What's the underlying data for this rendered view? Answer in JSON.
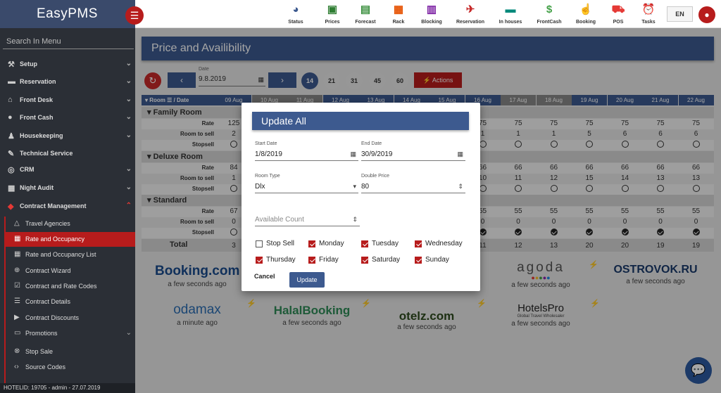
{
  "app": {
    "name": "EasyPMS",
    "menu_icon": "hamburger-icon"
  },
  "sidebar": {
    "search": "Search In Menu",
    "items": [
      {
        "label": "Setup",
        "icon": "gavel-icon"
      },
      {
        "label": "Reservation",
        "icon": "bed-icon"
      },
      {
        "label": "Front Desk",
        "icon": "home-icon"
      },
      {
        "label": "Front Cash",
        "icon": "coins-icon"
      },
      {
        "label": "Housekeeping",
        "icon": "person-icon"
      },
      {
        "label": "Technical Service",
        "icon": "wrench-icon"
      },
      {
        "label": "CRM",
        "icon": "globe-icon"
      },
      {
        "label": "Night Audit",
        "icon": "calendar-icon"
      },
      {
        "label": "Contract Management",
        "icon": "tag-icon"
      }
    ],
    "subitems": [
      {
        "label": "Travel Agencies"
      },
      {
        "label": "Rate and Occupancy"
      },
      {
        "label": "Rate and Occupancy List"
      },
      {
        "label": "Contract Wizard"
      },
      {
        "label": "Contract and Rate Codes"
      },
      {
        "label": "Contract Details"
      },
      {
        "label": "Contract Discounts"
      },
      {
        "label": "Promotions"
      },
      {
        "label": "Stop Sale"
      },
      {
        "label": "Source Codes"
      }
    ],
    "footer": "HOTELID: 19705 - admin - 27.07.2019"
  },
  "toolbar": [
    {
      "label": "Status",
      "icon": "pie-icon",
      "color": "#3d5a8f"
    },
    {
      "label": "Prices",
      "icon": "price-icon",
      "color": "#2e7d32"
    },
    {
      "label": "Forecast",
      "icon": "chart-icon",
      "color": "#388e3c"
    },
    {
      "label": "Rack",
      "icon": "grid-icon",
      "color": "#e65100"
    },
    {
      "label": "Blocking",
      "icon": "calendar-icon",
      "color": "#7b1fa2"
    },
    {
      "label": "Reservation",
      "icon": "plane-icon",
      "color": "#c62828"
    },
    {
      "label": "In houses",
      "icon": "bed-icon",
      "color": "#00897b"
    },
    {
      "label": "FrontCash",
      "icon": "dollar-icon",
      "color": "#43a047"
    },
    {
      "label": "Booking",
      "icon": "hand-icon",
      "color": "#e64a19"
    },
    {
      "label": "POS",
      "icon": "cart-icon",
      "color": "#e53935"
    },
    {
      "label": "Tasks",
      "icon": "alarm-icon",
      "color": "#e53935"
    }
  ],
  "lang": "EN",
  "page": {
    "title": "Price and Availibility"
  },
  "controls": {
    "date_label": "Date",
    "date_value": "9.8.2019",
    "days": [
      "14",
      "21",
      "31",
      "45",
      "60"
    ],
    "actions": "Actions"
  },
  "grid": {
    "header": "Room",
    "header_suffix": "/ Date",
    "dates": [
      "09 Aug",
      "10 Aug",
      "11 Aug",
      "12 Aug",
      "13 Aug",
      "14 Aug",
      "15 Aug",
      "16 Aug",
      "17 Aug",
      "18 Aug",
      "19 Aug",
      "20 Aug",
      "21 Aug",
      "22 Aug"
    ],
    "weekend_dates": [
      1,
      2,
      8,
      9
    ],
    "row_labels": {
      "rate": "Rate",
      "room": "Room to sell",
      "stop": "Stopsell"
    },
    "total_label": "Total",
    "sections": [
      {
        "name": "Family Room",
        "rate": [
          "125",
          "",
          "",
          "",
          "",
          "",
          "",
          "75",
          "75",
          "75",
          "75",
          "75",
          "75",
          "75"
        ],
        "room": [
          "2",
          "",
          "",
          "",
          "",
          "",
          "",
          "1",
          "1",
          "1",
          "5",
          "6",
          "6",
          "6"
        ],
        "stop": [
          0,
          0,
          0,
          0,
          0,
          0,
          0,
          0,
          0,
          0,
          0,
          0,
          0,
          0
        ]
      },
      {
        "name": "Deluxe Room",
        "rate": [
          "84",
          "",
          "",
          "",
          "",
          "",
          "",
          "66",
          "66",
          "66",
          "66",
          "66",
          "66",
          "66"
        ],
        "room": [
          "1",
          "",
          "",
          "",
          "",
          "",
          "",
          "10",
          "11",
          "12",
          "15",
          "14",
          "13",
          "13"
        ],
        "stop": [
          0,
          0,
          0,
          0,
          0,
          0,
          0,
          0,
          0,
          0,
          0,
          0,
          0,
          0
        ]
      },
      {
        "name": "Standard",
        "rate": [
          "67",
          "",
          "",
          "",
          "",
          "",
          "",
          "55",
          "55",
          "55",
          "55",
          "55",
          "55",
          "55"
        ],
        "room": [
          "0",
          "",
          "",
          "",
          "",
          "",
          "",
          "0",
          "0",
          "0",
          "0",
          "0",
          "0",
          "0"
        ],
        "stop": [
          0,
          0,
          0,
          0,
          0,
          0,
          0,
          1,
          1,
          1,
          1,
          1,
          1,
          1
        ]
      }
    ],
    "totals": [
      "3",
      "",
      "",
      "",
      "",
      "",
      "",
      "11",
      "12",
      "13",
      "20",
      "20",
      "19",
      "19"
    ]
  },
  "channels": [
    {
      "name": "Booking.com",
      "time": "a few seconds ago",
      "color": "#1a4b8c"
    },
    {
      "name": "agoda",
      "time": "a few seconds ago",
      "color": "#555"
    },
    {
      "name": "OSTROVOK.RU",
      "time": "a few seconds ago",
      "color": "#1a3a6b"
    },
    {
      "name": "odamax",
      "time": "a minute ago",
      "color": "#2c6db3"
    },
    {
      "name": "HalalBooking",
      "time": "a few seconds ago",
      "color": "#2e8b57"
    },
    {
      "name": "otelz.com",
      "time": "a few seconds ago",
      "color": "#2d4a1e"
    },
    {
      "name": "HotelsPro",
      "tagline": "Global Travel Wholesaler",
      "time": "a few seconds ago",
      "color": "#222"
    }
  ],
  "modal": {
    "title": "Update All",
    "start_label": "Start Date",
    "start_value": "1/8/2019",
    "end_label": "End Date",
    "end_value": "30/9/2019",
    "room_type_label": "Room Type",
    "room_type_value": "Dlx",
    "price_label": "Double Price",
    "price_value": "80",
    "count_placeholder": "Available Count",
    "checkboxes": [
      {
        "label": "Stop Sell",
        "checked": false
      },
      {
        "label": "Monday",
        "checked": true
      },
      {
        "label": "Tuesday",
        "checked": true
      },
      {
        "label": "Wednesday",
        "checked": true
      },
      {
        "label": "Thursday",
        "checked": true
      },
      {
        "label": "Friday",
        "checked": true
      },
      {
        "label": "Saturday",
        "checked": true
      },
      {
        "label": "Sunday",
        "checked": true
      }
    ],
    "cancel": "Cancel",
    "update": "Update"
  },
  "colors": {
    "primary": "#3d5a8f",
    "accent": "#b71c1c",
    "sidebar": "#2b2f36"
  }
}
